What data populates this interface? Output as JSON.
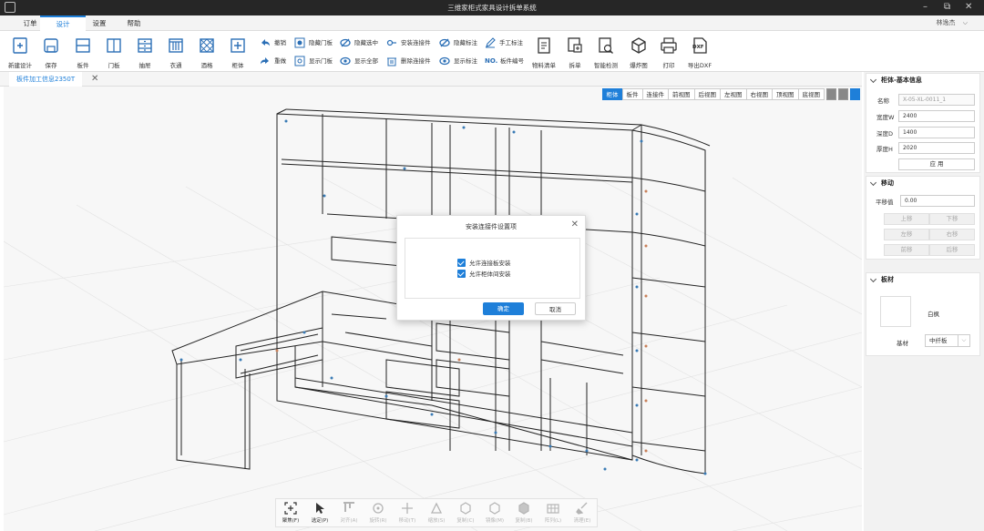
{
  "window": {
    "title": "三维家柜式家具设计拆单系统",
    "minimize": "–",
    "restore": "⧉",
    "close": "✕"
  },
  "menu": {
    "tabs": [
      "订单",
      "设计",
      "设置",
      "帮助"
    ],
    "active": 1,
    "user": "林逸杰",
    "user_caret": "⌵"
  },
  "ribbon": {
    "big": [
      {
        "label": "新建设计",
        "icon": "new-design-icon"
      },
      {
        "label": "保存",
        "icon": "save-icon"
      },
      {
        "label": "板件",
        "icon": "board-icon"
      },
      {
        "label": "门板",
        "icon": "door-icon"
      },
      {
        "label": "抽屉",
        "icon": "drawer-icon"
      },
      {
        "label": "衣通",
        "icon": "rail-icon"
      },
      {
        "label": "酒格",
        "icon": "wine-rack-icon"
      },
      {
        "label": "柜体",
        "icon": "cabinet-icon"
      }
    ],
    "small": [
      {
        "label": "撤销",
        "icon": "undo-icon"
      },
      {
        "label": "重做",
        "icon": "redo-icon"
      },
      {
        "label": "隐藏门板",
        "icon": "hide-door-icon"
      },
      {
        "label": "显示门板",
        "icon": "show-door-icon"
      },
      {
        "label": "隐藏选中",
        "icon": "hide-selected-icon"
      },
      {
        "label": "显示全部",
        "icon": "show-all-icon"
      },
      {
        "label": "安装连接件",
        "icon": "install-connector-icon"
      },
      {
        "label": "删除连接件",
        "icon": "delete-connector-icon"
      },
      {
        "label": "隐藏标注",
        "icon": "hide-annotation-icon"
      },
      {
        "label": "显示标注",
        "icon": "show-annotation-icon"
      },
      {
        "label": "手工标注",
        "icon": "manual-annotation-icon"
      },
      {
        "label": "板件编号",
        "icon": "board-number-icon",
        "prefix": "NO."
      }
    ],
    "big2": [
      {
        "label": "物料清单",
        "icon": "bom-icon"
      },
      {
        "label": "拆单",
        "icon": "split-order-icon"
      },
      {
        "label": "智能检测",
        "icon": "smart-check-icon"
      },
      {
        "label": "爆炸图",
        "icon": "explode-icon"
      },
      {
        "label": "打印",
        "icon": "print-icon"
      },
      {
        "label": "导出DXF",
        "icon": "export-dxf-icon",
        "badge": "DXF"
      }
    ]
  },
  "doc_tab": {
    "label": "板件加工信息2350T",
    "close": "✕"
  },
  "viewbar": {
    "buttons": [
      "柜体",
      "板件",
      "连接件",
      "前视图",
      "后视图",
      "左视图",
      "右视图",
      "顶视图",
      "底视图"
    ],
    "active": 0
  },
  "tools": [
    {
      "label": "聚焦(F)",
      "enabled": true
    },
    {
      "label": "选定(P)",
      "enabled": true
    },
    {
      "label": "对齐(A)",
      "enabled": false
    },
    {
      "label": "旋转(R)",
      "enabled": false
    },
    {
      "label": "移动(T)",
      "enabled": false
    },
    {
      "label": "缩放(S)",
      "enabled": false
    },
    {
      "label": "复制(C)",
      "enabled": false
    },
    {
      "label": "镜像(M)",
      "enabled": false
    },
    {
      "label": "复制(B)",
      "enabled": false
    },
    {
      "label": "阵列(L)",
      "enabled": false
    },
    {
      "label": "清理(E)",
      "enabled": false
    }
  ],
  "dialog": {
    "title": "安装连接件设置项",
    "close": "✕",
    "options": [
      "允许连接板安装",
      "允许柜体间安装"
    ],
    "ok": "确定",
    "cancel": "取消"
  },
  "panel_basic": {
    "title": "柜体-基本信息",
    "fields": [
      {
        "label": "名称",
        "value": "X-05-XL-0011_1",
        "readonly": true
      },
      {
        "label": "宽度W",
        "value": "2400"
      },
      {
        "label": "深度D",
        "value": "1400"
      },
      {
        "label": "厚度H",
        "value": "2020"
      }
    ],
    "apply": "应 用"
  },
  "panel_move": {
    "title": "移动",
    "offset_label": "平移值",
    "offset_value": "0.00",
    "buttons": [
      "上移",
      "下移",
      "左移",
      "右移",
      "前移",
      "后移"
    ]
  },
  "panel_board": {
    "title": "板材",
    "swatch_label": "白枫",
    "base_label": "基材",
    "base_value": "中纤板",
    "caret": "⌵"
  },
  "colors": {
    "accent": "#1e7fd9",
    "titlebar": "#262626"
  }
}
